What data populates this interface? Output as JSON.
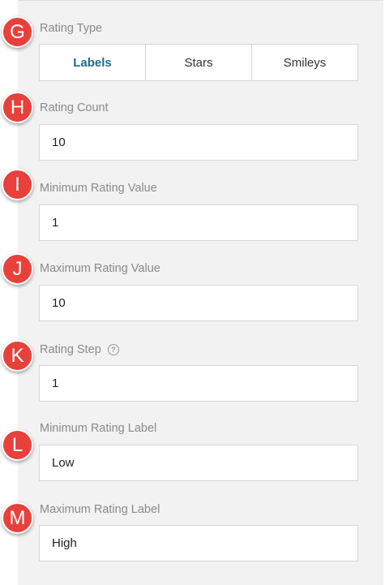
{
  "rating_type": {
    "badge": "G",
    "label": "Rating Type",
    "options": [
      "Labels",
      "Stars",
      "Smileys"
    ],
    "selected": "Labels"
  },
  "rating_count": {
    "badge": "H",
    "label": "Rating Count",
    "value": "10"
  },
  "min_value": {
    "badge": "I",
    "label": "Minimum Rating Value",
    "value": "1"
  },
  "max_value": {
    "badge": "J",
    "label": "Maximum Rating Value",
    "value": "10"
  },
  "rating_step": {
    "badge": "K",
    "label": "Rating Step",
    "help": "?",
    "value": "1"
  },
  "min_label": {
    "badge": "L",
    "label": "Minimum Rating Label",
    "value": "Low"
  },
  "max_label": {
    "badge": "M",
    "label": "Maximum Rating Label",
    "value": "High"
  },
  "colors": {
    "badge": "#e8403a",
    "accent": "#1e6d8a",
    "panel": "#f2f2f2"
  }
}
